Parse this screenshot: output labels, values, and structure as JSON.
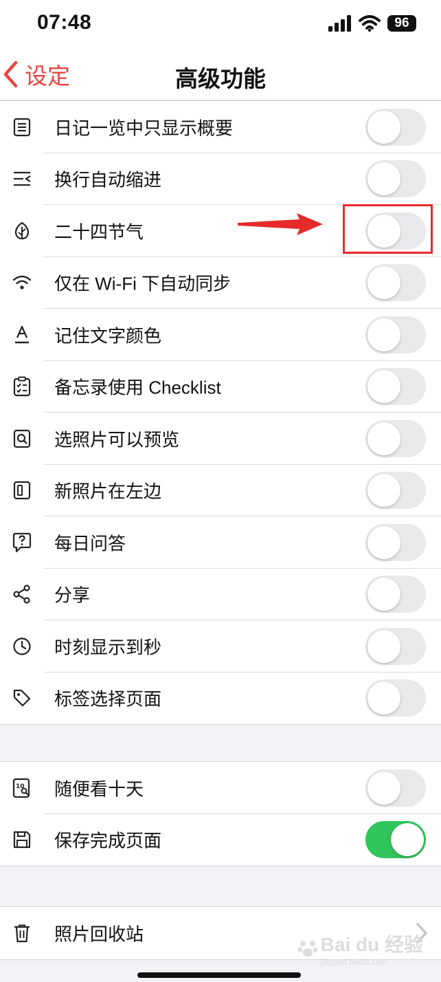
{
  "status_bar": {
    "time": "07:48",
    "battery": "96"
  },
  "nav": {
    "back_label": "设定",
    "title": "高级功能"
  },
  "group1": {
    "rows": [
      {
        "label": "日记一览中只显示概要",
        "icon": "list-document-icon",
        "on": false
      },
      {
        "label": "换行自动缩进",
        "icon": "indent-icon",
        "on": false
      },
      {
        "label": "二十四节气",
        "icon": "leaf-icon",
        "on": false
      },
      {
        "label": "仅在 Wi-Fi 下自动同步",
        "icon": "wifi-icon",
        "on": false
      },
      {
        "label": "记住文字颜色",
        "icon": "text-color-icon",
        "on": false
      },
      {
        "label": "备忘录使用 Checklist",
        "icon": "checklist-icon",
        "on": false
      },
      {
        "label": "选照片可以预览",
        "icon": "photo-preview-icon",
        "on": false
      },
      {
        "label": "新照片在左边",
        "icon": "photo-left-icon",
        "on": false
      },
      {
        "label": "每日问答",
        "icon": "question-bubble-icon",
        "on": false
      },
      {
        "label": "分享",
        "icon": "share-icon",
        "on": false
      },
      {
        "label": "时刻显示到秒",
        "icon": "clock-icon",
        "on": false
      },
      {
        "label": "标签选择页面",
        "icon": "tag-icon",
        "on": false
      }
    ]
  },
  "group2": {
    "rows": [
      {
        "label": "随便看十天",
        "icon": "ten-days-icon",
        "on": false
      },
      {
        "label": "保存完成页面",
        "icon": "save-icon",
        "on": true
      }
    ]
  },
  "group3": {
    "rows": [
      {
        "label": "照片回收站",
        "icon": "trash-icon"
      }
    ]
  },
  "watermark": {
    "text": "Bai du 经验",
    "sub": "jingyan.baidu.com"
  },
  "colors": {
    "accent": "#e94540",
    "toggle_on": "#2fc55a",
    "toggle_off": "#e9e9eb",
    "annotation": "#e62a2a"
  }
}
